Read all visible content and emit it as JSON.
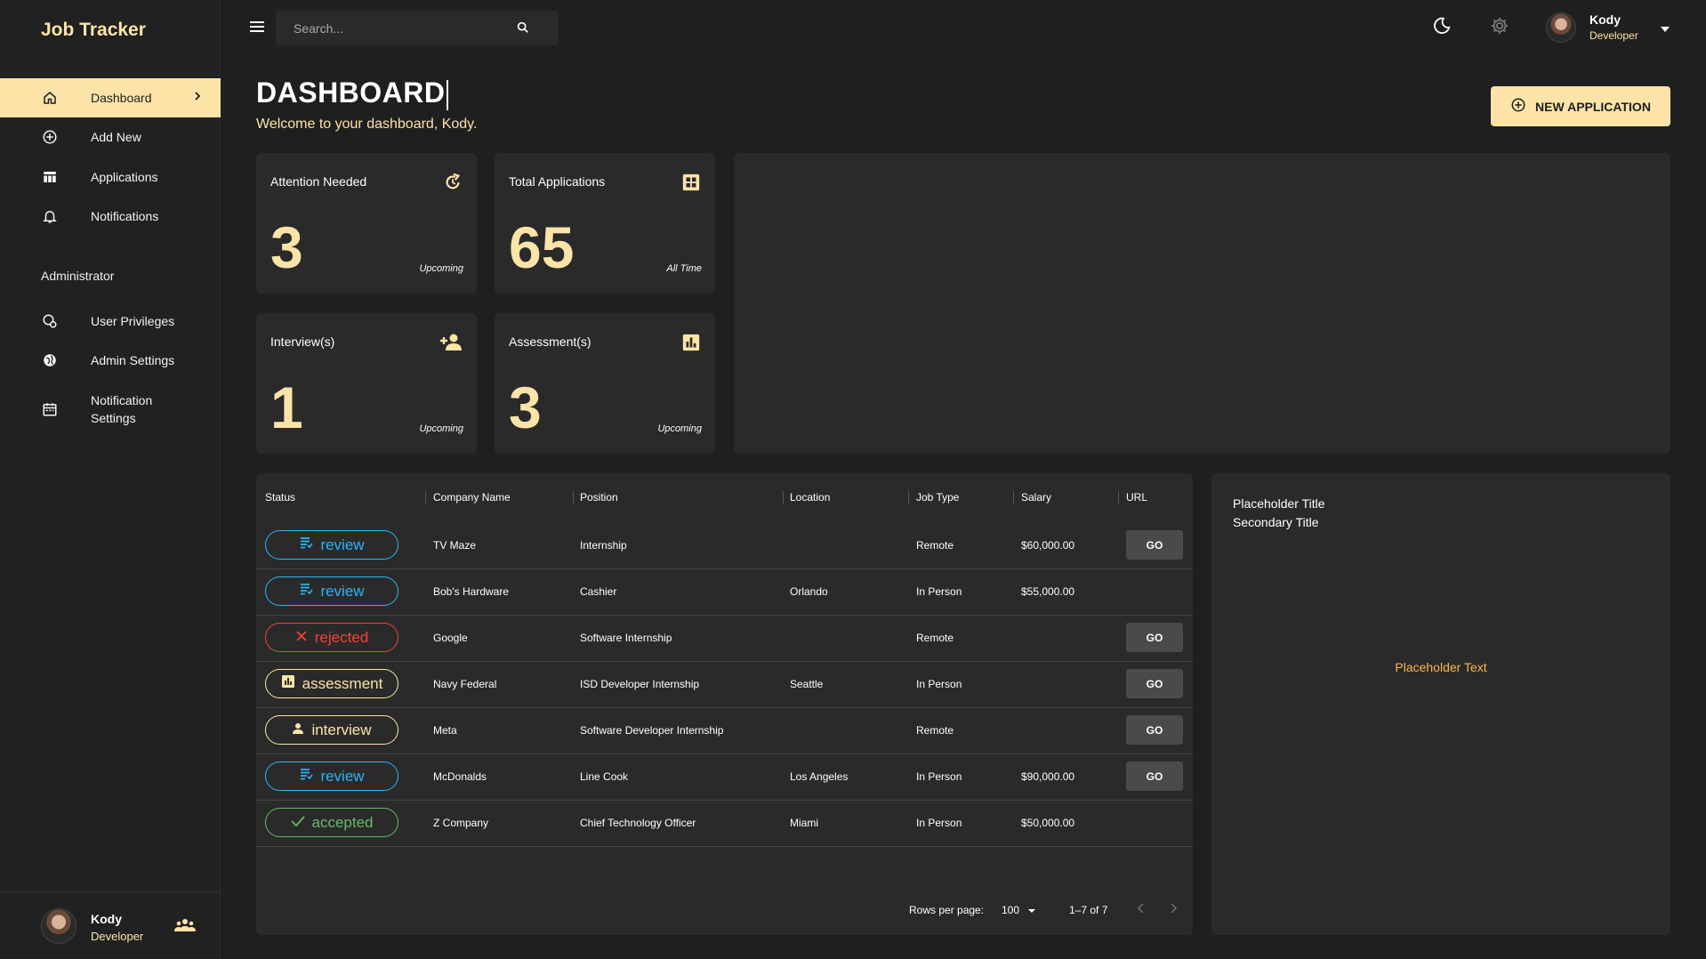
{
  "app": {
    "brand": "Job Tracker"
  },
  "sidebar": {
    "items": [
      {
        "label": "Dashboard",
        "icon": "home-icon"
      },
      {
        "label": "Add New",
        "icon": "add-circle-icon"
      },
      {
        "label": "Applications",
        "icon": "table-icon"
      },
      {
        "label": "Notifications",
        "icon": "bell-icon"
      }
    ],
    "admin_label": "Administrator",
    "admin_items": [
      {
        "label": "User Privileges",
        "icon": "user-privileges-icon"
      },
      {
        "label": "Admin Settings",
        "icon": "globe-icon"
      },
      {
        "label": "Notification",
        "label2": "Settings",
        "icon": "calendar-icon"
      }
    ],
    "footer": {
      "name": "Kody",
      "role": "Developer",
      "icon": "group-icon"
    }
  },
  "topbar": {
    "search_placeholder": "Search...",
    "user": {
      "name": "Kody",
      "role": "Developer"
    }
  },
  "header": {
    "title": "DASHBOARD",
    "subtitle": "Welcome to your dashboard, Kody.",
    "new_button": "NEW APPLICATION"
  },
  "stats": [
    {
      "title": "Attention Needed",
      "value": "3",
      "foot": "Upcoming",
      "icon": "refresh-icon"
    },
    {
      "title": "Total Applications",
      "value": "65",
      "foot": "All Time",
      "icon": "grid-icon"
    },
    {
      "title": "Interview(s)",
      "value": "1",
      "foot": "Upcoming",
      "icon": "person-add-icon"
    },
    {
      "title": "Assessment(s)",
      "value": "3",
      "foot": "Upcoming",
      "icon": "bar-chart-icon"
    }
  ],
  "table": {
    "headers": [
      "Status",
      "Company Name",
      "Position",
      "Location",
      "Job Type",
      "Salary",
      "URL"
    ],
    "rows": [
      {
        "status": "review",
        "company": "TV Maze",
        "position": "Internship",
        "location": "",
        "type": "Remote",
        "salary": "$60,000.00",
        "go": "GO"
      },
      {
        "status": "review",
        "company": "Bob's Hardware",
        "position": "Cashier",
        "location": "Orlando",
        "type": "In Person",
        "salary": "$55,000.00",
        "go": ""
      },
      {
        "status": "rejected",
        "company": "Google",
        "position": "Software Internship",
        "location": "",
        "type": "Remote",
        "salary": "",
        "go": "GO"
      },
      {
        "status": "assessment",
        "company": "Navy Federal",
        "position": "ISD Developer Internship",
        "location": "Seattle",
        "type": "In Person",
        "salary": "",
        "go": "GO"
      },
      {
        "status": "interview",
        "company": "Meta",
        "position": "Software Developer Internship",
        "location": "",
        "type": "Remote",
        "salary": "",
        "go": "GO"
      },
      {
        "status": "review",
        "company": "McDonalds",
        "position": "Line Cook",
        "location": "Los Angeles",
        "type": "In Person",
        "salary": "$90,000.00",
        "go": "GO"
      },
      {
        "status": "accepted",
        "company": "Z Company",
        "position": "Chief Technology Officer",
        "location": "Miami",
        "type": "In Person",
        "salary": "$50,000.00",
        "go": ""
      }
    ],
    "pagination": {
      "rows_label": "Rows per page:",
      "rows_value": "100",
      "range": "1–7 of 7"
    }
  },
  "panel": {
    "title": "Placeholder Title",
    "subtitle": "Secondary Title",
    "text": "Placeholder Text"
  },
  "colors": {
    "accent": "#fce4a8",
    "review": "#29b6f6",
    "rejected": "#f44336",
    "accepted": "#66bb6a",
    "placeholder": "#fcb74d"
  }
}
